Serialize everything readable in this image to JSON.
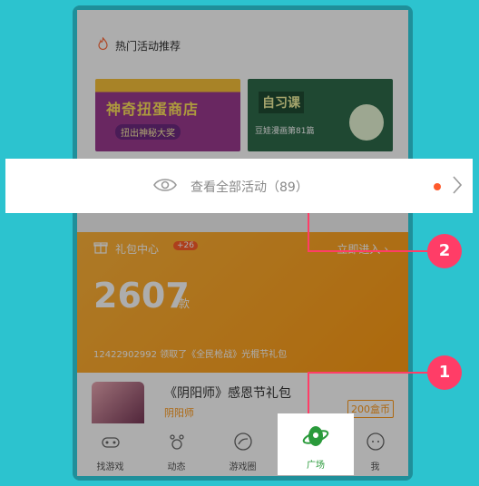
{
  "hot_section": {
    "title": "热门活动推荐",
    "banners": [
      {
        "title": "神奇扭蛋商店",
        "subtitle": "扭出神秘大奖"
      },
      {
        "title": "自习课",
        "subtitle": "豆娃漫画第81篇"
      }
    ]
  },
  "all_activities": {
    "label": "查看全部活动（89）"
  },
  "gift_center": {
    "title": "礼包中心",
    "badge": "+26",
    "enter_label": "立即进入",
    "count": "2607",
    "unit": "款",
    "log": "12422902992 领取了《全民枪战》光棍节礼包"
  },
  "gift_item": {
    "title": "《阴阳师》感恩节礼包",
    "game": "阴阳师",
    "price": "200盒币"
  },
  "tabbar": [
    {
      "label": "找游戏",
      "icon": "gamepad-icon"
    },
    {
      "label": "动态",
      "icon": "paw-icon"
    },
    {
      "label": "游戏圈",
      "icon": "circle-icon"
    },
    {
      "label": "广场",
      "icon": "planet-icon"
    },
    {
      "label": "我",
      "icon": "face-icon"
    }
  ],
  "markers": {
    "one": "1",
    "two": "2"
  },
  "colors": {
    "background": "#2cc3cf",
    "accent_orange": "#ff9a1a",
    "marker": "#ff3d67",
    "plaza_green": "#2a9a3b"
  }
}
